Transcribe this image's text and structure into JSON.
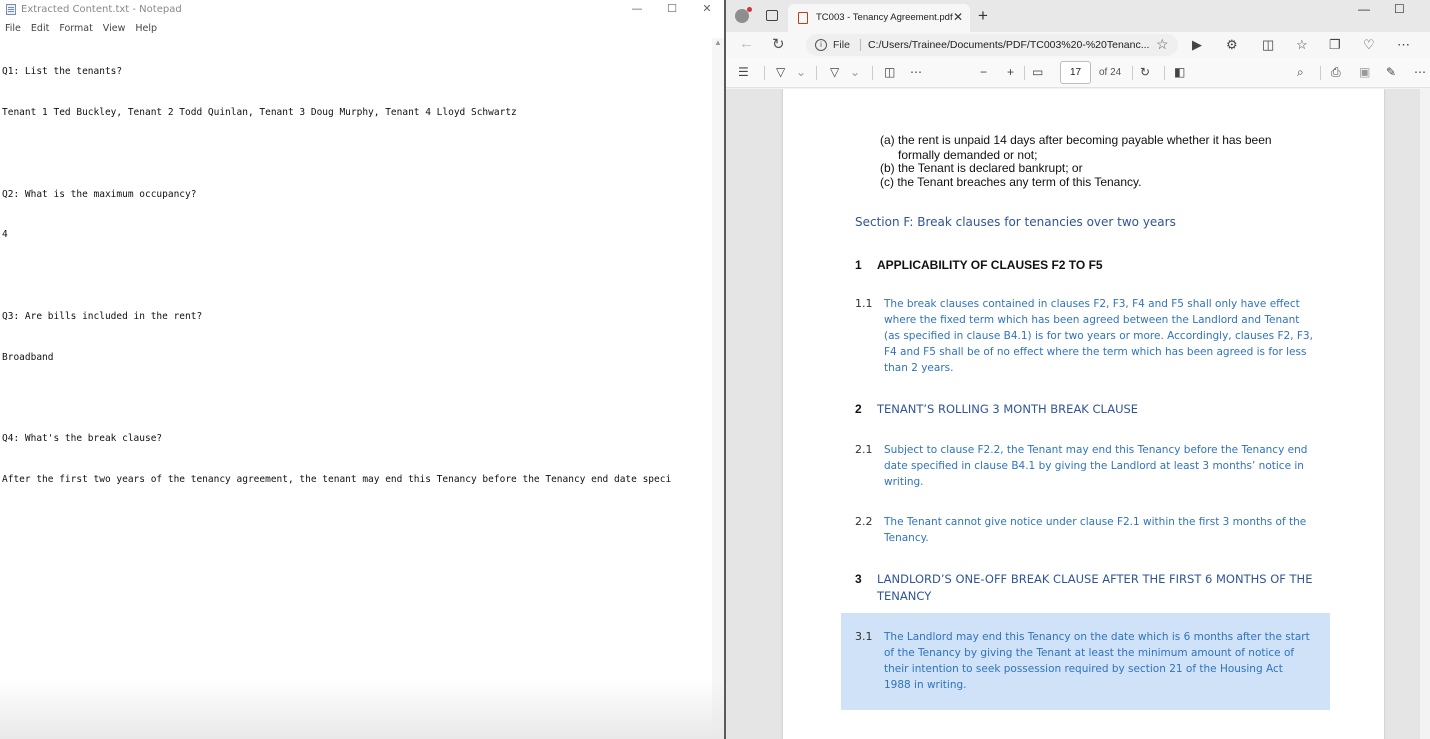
{
  "notepad": {
    "title": "Extracted Content.txt - Notepad",
    "window_controls": {
      "minimize": "—",
      "maximize": "☐",
      "close": "✕"
    },
    "menu": [
      "File",
      "Edit",
      "Format",
      "View",
      "Help"
    ],
    "lines": [
      "Q1: List the tenants?",
      "Tenant 1 Ted Buckley, Tenant 2 Todd Quinlan, Tenant 3 Doug Murphy, Tenant 4 Lloyd Schwartz",
      "",
      "Q2: What is the maximum occupancy?",
      "4",
      "",
      "Q3: Are bills included in the rent?",
      "Broadband",
      "",
      "Q4: What's the break clause?",
      "After the first two years of the tenancy agreement, the tenant may end this Tenancy before the Tenancy end date speci"
    ]
  },
  "browser": {
    "tab_title": "TC003 - Tenancy Agreement.pdf",
    "tab_close": "✕",
    "new_tab": "+",
    "address": {
      "scheme_label": "File",
      "url": "C:/Users/Trainee/Documents/PDF/TC003%20-%20Tenanc..."
    },
    "pdf_toolbar": {
      "page_number": "17",
      "page_total": "of 24",
      "zoom_out": "−",
      "zoom_in": "+"
    },
    "colors": {
      "heading_blue": "#2f5597",
      "body_blue": "#2f73c0",
      "highlight": "#cfe2f7",
      "profile_dot": "#d13438"
    }
  },
  "pdf": {
    "list_a": "(a) the rent is unpaid 14 days after becoming payable whether it has been",
    "list_a2": "formally demanded or not;",
    "list_b": "(b) the Tenant is declared bankrupt; or",
    "list_c": "(c) the Tenant breaches any term of this Tenancy.",
    "section_title": "Section F: Break clauses for tenancies over two years",
    "h1_num": "1",
    "h1_text": "APPLICABILITY OF CLAUSES F2 TO F5",
    "c11_num": "1.1",
    "c11_lines": [
      "The break clauses contained in clauses F2, F3, F4 and F5 shall only have effect",
      "where the fixed term which has been agreed between the Landlord and Tenant",
      "(as specified in clause B4.1) is for two years or more. Accordingly, clauses F2, F3,",
      "F4 and F5 shall be of no effect where the term which has been agreed is for less",
      "than 2 years."
    ],
    "h2_num": "2",
    "h2_text": "TENANT’S ROLLING 3 MONTH BREAK CLAUSE",
    "c21_num": "2.1",
    "c21_lines": [
      "Subject to clause F2.2, the Tenant may end this Tenancy before the Tenancy end",
      "date specified in clause B4.1 by giving the Landlord at least 3 months’ notice in",
      "writing."
    ],
    "c22_num": "2.2",
    "c22_lines": [
      "The Tenant cannot give notice under clause F2.1 within the first 3 months of the",
      "Tenancy."
    ],
    "h3_num": "3",
    "h3_lines": [
      "LANDLORD’S ONE-OFF BREAK CLAUSE AFTER THE FIRST 6 MONTHS OF THE",
      "TENANCY"
    ],
    "c31_num": "3.1",
    "c31_lines": [
      "The Landlord may end this Tenancy on the date which is 6 months after the start",
      "of the Tenancy by giving the Tenant at least the minimum amount of notice of",
      "their intention to seek possession required by section 21 of the Housing Act",
      "1988 in writing."
    ]
  }
}
